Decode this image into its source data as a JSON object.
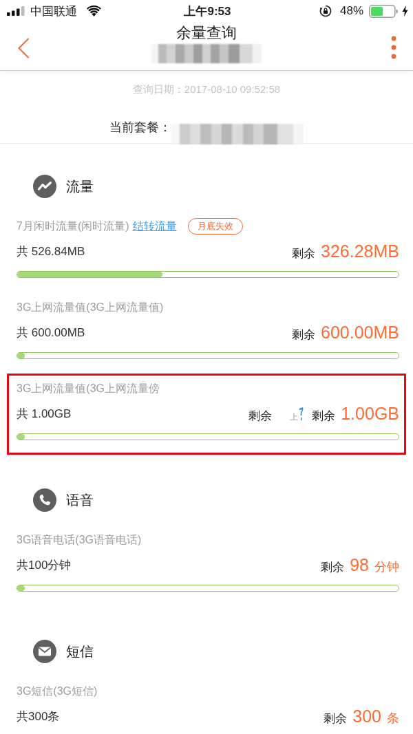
{
  "status_bar": {
    "carrier": "中国联通",
    "time": "上午9:53",
    "battery": "48%"
  },
  "nav": {
    "title": "余量查询",
    "subtitle_masked": true
  },
  "query": {
    "date": "查询日期：2017-08-10 09:52:58",
    "plan_label": "当前套餐：",
    "plan_masked": true
  },
  "sections": [
    {
      "kind": "data",
      "title": "流量",
      "items": [
        {
          "name": "7月闲时流量(闲时流量)",
          "link": "结转流量",
          "badge": "月底失效",
          "total": "共 526.84MB",
          "remaining_label": "剩余",
          "remaining_value": "326.28MB",
          "level": 0.38,
          "highlighted": false
        },
        {
          "name": "3G上网流量值(3G上网流量值)",
          "total": "共 600.00MB",
          "remaining_label": "剩余",
          "remaining_value": "600.00MB",
          "level": 0.02,
          "highlighted": false
        },
        {
          "name": "3G上网流量值(3G上网流量傍",
          "total": "共 1.00GB",
          "stray_label": "剩余",
          "stray_fragment": "上",
          "remaining_label": "剩余",
          "remaining_value": "1.00GB",
          "level": 0.02,
          "highlighted": true
        }
      ]
    },
    {
      "kind": "voice",
      "title": "语音",
      "items": [
        {
          "name": "3G语音电话(3G语音电话)",
          "total": "共100分钟",
          "remaining_label": "剩余",
          "remaining_value": "98",
          "remaining_unit": "分钟",
          "level": 0.02,
          "highlighted": false
        }
      ]
    },
    {
      "kind": "sms",
      "title": "短信",
      "items": [
        {
          "name": "3G短信(3G短信)",
          "total": "共300条",
          "remaining_label": "剩余",
          "remaining_value": "300",
          "remaining_unit": "条",
          "highlighted": false
        }
      ]
    }
  ]
}
